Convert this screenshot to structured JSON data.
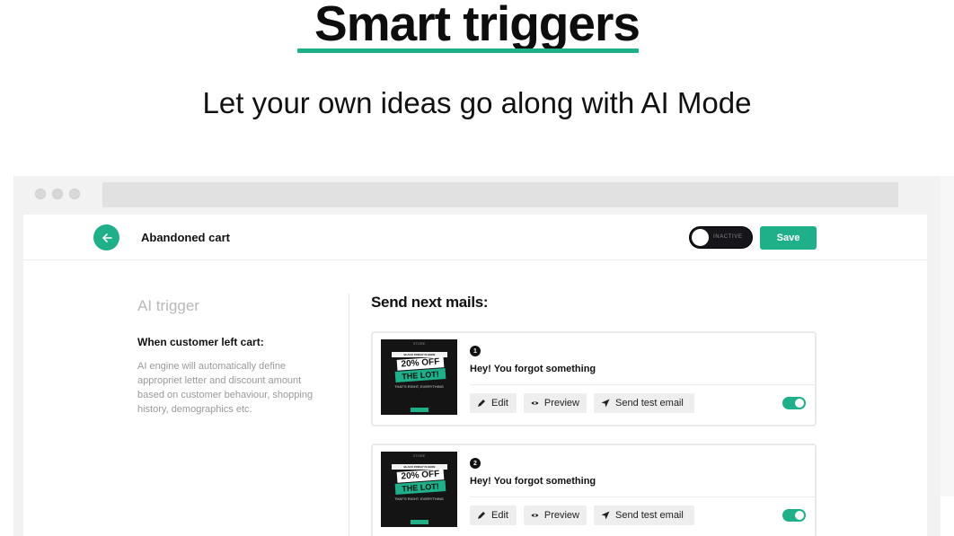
{
  "hero": {
    "title": "Smart triggers",
    "subtitle": "Let your own ideas go along with AI Mode"
  },
  "header": {
    "title": "Abandoned cart",
    "status_toggle": "INACTIVE",
    "save_label": "Save"
  },
  "left": {
    "section_label": "AI trigger",
    "condition": "When customer left cart:",
    "description": "AI engine will automatically define appropriet letter and discount amount based on customer behaviour, shopping history, demographics etc."
  },
  "main": {
    "heading": "Send next mails:",
    "mails": [
      {
        "number": "1",
        "subject": "Hey! You forgot something",
        "thumb": {
          "top": "STORE",
          "banner": "BLACK FRIDAY IS HERE",
          "offer": "20% OFF",
          "lot": "THE LOT!",
          "text": "THAT'S RIGHT, EVERYTHING"
        },
        "edit": "Edit",
        "preview": "Preview",
        "send_test": "Send test email",
        "enabled": true
      },
      {
        "number": "2",
        "subject": "Hey! You forgot something",
        "thumb": {
          "top": "STORE",
          "banner": "BLACK FRIDAY IS HERE",
          "offer": "20% OFF",
          "lot": "THE LOT!",
          "text": "THAT'S RIGHT, EVERYTHING"
        },
        "edit": "Edit",
        "preview": "Preview",
        "send_test": "Send test email",
        "enabled": true
      }
    ]
  },
  "colors": {
    "accent": "#1fb08a",
    "dark": "#16161a"
  }
}
